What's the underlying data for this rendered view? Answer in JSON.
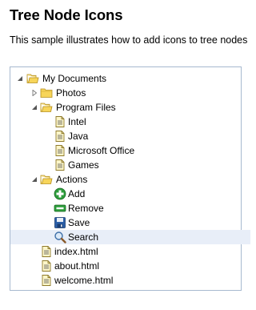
{
  "page": {
    "title": "Tree Node Icons",
    "description": "This sample illustrates how to add icons to tree nodes"
  },
  "tree": {
    "my_documents": {
      "label": "My Documents",
      "icon": "folder-open-icon"
    },
    "photos": {
      "label": "Photos",
      "icon": "folder-icon"
    },
    "program_files": {
      "label": "Program Files",
      "icon": "folder-open-icon"
    },
    "intel": {
      "label": "Intel",
      "icon": "document-icon"
    },
    "java": {
      "label": "Java",
      "icon": "document-icon"
    },
    "microsoft_office": {
      "label": "Microsoft Office",
      "icon": "document-icon"
    },
    "games": {
      "label": "Games",
      "icon": "document-icon"
    },
    "actions": {
      "label": "Actions",
      "icon": "folder-open-icon"
    },
    "add": {
      "label": "Add",
      "icon": "add-icon"
    },
    "remove": {
      "label": "Remove",
      "icon": "remove-icon"
    },
    "save": {
      "label": "Save",
      "icon": "save-icon"
    },
    "search": {
      "label": "Search",
      "icon": "search-icon",
      "selected": true
    },
    "index_html": {
      "label": "index.html",
      "icon": "document-icon"
    },
    "about_html": {
      "label": "about.html",
      "icon": "document-icon"
    },
    "welcome_html": {
      "label": "welcome.html",
      "icon": "document-icon"
    }
  },
  "colors": {
    "panel_border": "#a7b9cf",
    "selected_row": "#e8eef8",
    "folder_fill": "#f7d55a",
    "folder_stroke": "#b58f1e"
  }
}
